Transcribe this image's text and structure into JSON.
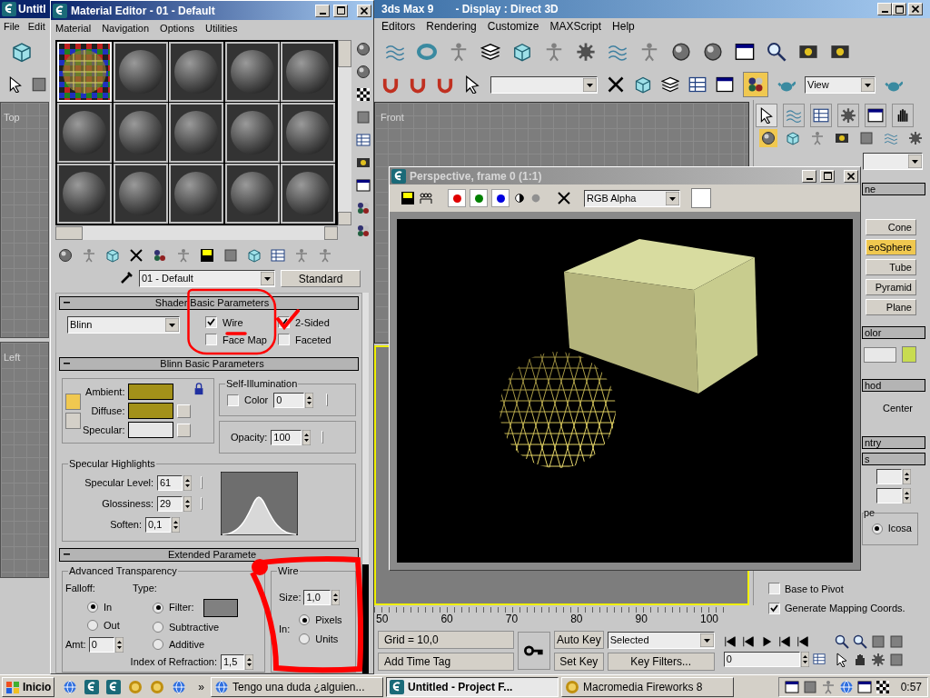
{
  "main_window": {
    "title": "Untitl",
    "app_title": "3ds Max 9",
    "display_title": "- Display : Direct 3D",
    "menu_left": [
      "File",
      "Edit"
    ],
    "menu_right": [
      "Editors",
      "Rendering",
      "Customize",
      "MAXScript",
      "Help"
    ],
    "view_dropdown": "View",
    "viewports_left": [
      {
        "label": "Top"
      },
      {
        "label": "Left"
      }
    ],
    "front_viewport": {
      "label": "Front"
    },
    "command_panel": {
      "tabs": [
        {
          "selected": true
        },
        {
          "selected": false
        },
        {
          "selected": false
        },
        {
          "selected": false
        },
        {
          "selected": false
        },
        {
          "selected": false
        }
      ],
      "categories": [
        {
          "selected": true
        },
        {
          "selected": false
        },
        {
          "selected": false
        },
        {
          "selected": false
        },
        {
          "selected": false
        },
        {
          "selected": false
        },
        {
          "selected": false
        }
      ],
      "rollouts": [
        "ne",
        "olor",
        "hod",
        "ntry",
        "s"
      ],
      "buttons": [
        {
          "label": "Cone",
          "selected": false
        },
        {
          "label": "eoSphere",
          "selected": true
        },
        {
          "label": "Tube",
          "selected": false
        },
        {
          "label": "Pyramid",
          "selected": false
        },
        {
          "label": "Plane",
          "selected": false
        }
      ],
      "center_option": "Center",
      "type_group": "pe",
      "icosa": {
        "label": "Icosa",
        "selected": true
      },
      "checkboxes": [
        {
          "label": "Base to Pivot",
          "checked": false
        },
        {
          "label": "Generate Mapping Coords.",
          "checked": true
        }
      ]
    },
    "timeline": {
      "ticks": [
        "50",
        "60",
        "70",
        "80",
        "90",
        "100"
      ]
    },
    "status": {
      "grid": "Grid = 10,0",
      "add_time_tag": "Add Time Tag"
    },
    "animation": {
      "auto_key": "Auto Key",
      "set_key": "Set Key",
      "key_mode": "Selected",
      "key_filters": "Key Filters...",
      "frame": "0"
    }
  },
  "material_editor": {
    "title": "Material Editor - 01 - Default",
    "menus": [
      "Material",
      "Navigation",
      "Options",
      "Utilities"
    ],
    "slots": [
      {
        "kind": "checker",
        "selected": true
      },
      {
        "kind": "gray",
        "selected": false
      },
      {
        "kind": "gray",
        "selected": false
      },
      {
        "kind": "gray",
        "selected": false
      },
      {
        "kind": "gray",
        "selected": false
      },
      {
        "kind": "gray",
        "selected": false
      },
      {
        "kind": "gray",
        "selected": false
      },
      {
        "kind": "gray",
        "selected": false
      },
      {
        "kind": "gray",
        "selected": false
      },
      {
        "kind": "gray",
        "selected": false
      },
      {
        "kind": "gray",
        "selected": false
      },
      {
        "kind": "gray",
        "selected": false
      },
      {
        "kind": "gray",
        "selected": false
      },
      {
        "kind": "gray",
        "selected": false
      },
      {
        "kind": "gray",
        "selected": false
      }
    ],
    "material_name": "01 - Default",
    "material_type": "Standard",
    "shader_rollout": {
      "title": "Shader Basic Parameters",
      "shader": "Blinn",
      "options": [
        {
          "label": "Wire",
          "checked": true
        },
        {
          "label": "2-Sided",
          "checked": true
        },
        {
          "label": "Face Map",
          "checked": false
        },
        {
          "label": "Faceted",
          "checked": false
        }
      ]
    },
    "basic_rollout": {
      "title": "Blinn Basic Parameters",
      "colors": [
        {
          "label": "Ambient:",
          "color": "#a39119"
        },
        {
          "label": "Diffuse:",
          "color": "#a39119"
        },
        {
          "label": "Specular:",
          "color": "#e6e6e6"
        }
      ],
      "self_illumination": {
        "title": "Self-Illumination",
        "label": "Color",
        "checked": false,
        "value": "0"
      },
      "opacity": {
        "label": "Opacity:",
        "value": "100"
      },
      "specular_highlights": {
        "title": "Specular Highlights",
        "fields": [
          {
            "label": "Specular Level:",
            "value": "61"
          },
          {
            "label": "Glossiness:",
            "value": "29"
          },
          {
            "label": "Soften:",
            "value": "0,1"
          }
        ]
      }
    },
    "extended_rollout": {
      "title": "Extended Paramete",
      "advanced_transparency": {
        "title": "Advanced Transparency",
        "falloff_label": "Falloff:",
        "falloff": [
          {
            "label": "In",
            "selected": true
          },
          {
            "label": "Out",
            "selected": false
          }
        ],
        "type_label": "Type:",
        "types": [
          {
            "label": "Filter:",
            "selected": true
          },
          {
            "label": "Subtractive",
            "selected": false
          },
          {
            "label": "Additive",
            "selected": false
          }
        ],
        "amt_label": "Amt:",
        "amt": "0",
        "ior_label": "Index of Refraction:",
        "ior": "1,5"
      },
      "wire": {
        "title": "Wire",
        "size_label": "Size:",
        "size": "1,0",
        "in_label": "In:",
        "units": [
          {
            "label": "Pixels",
            "selected": true
          },
          {
            "label": "Units",
            "selected": false
          }
        ]
      }
    }
  },
  "render_window": {
    "title": "Perspective, frame 0 (1:1)",
    "channels": [
      {
        "color": "#e00000"
      },
      {
        "color": "#008000"
      },
      {
        "color": "#0000e0"
      }
    ],
    "channel_mode": "RGB Alpha"
  },
  "taskbar": {
    "start": "Inicio",
    "overflow": "»",
    "tasks": [
      {
        "label": "Tengo una duda ¿alguien...",
        "selected": false
      },
      {
        "label": "Untitled - Project F...",
        "selected": true
      },
      {
        "label": "Macromedia Fireworks 8",
        "selected": false
      }
    ],
    "clock": "0:57"
  }
}
